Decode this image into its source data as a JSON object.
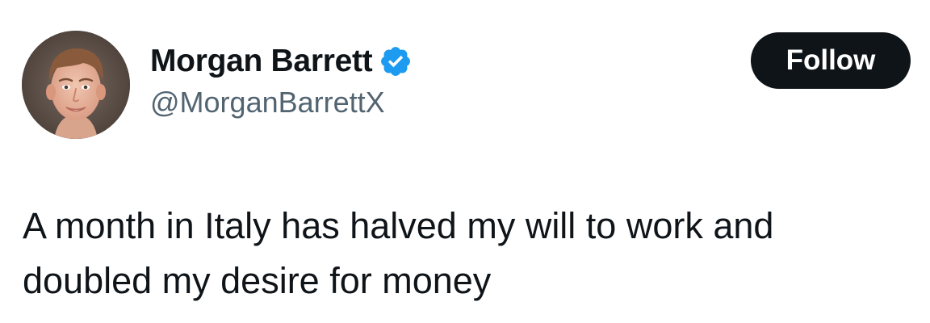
{
  "author": {
    "display_name": "Morgan Barrett",
    "handle": "@MorganBarrettX",
    "verified": true,
    "verified_badge_color": "#1d9bf0"
  },
  "actions": {
    "follow_label": "Follow"
  },
  "tweet": {
    "text": "A month in Italy has halved my will to work and\ndoubled my desire for money"
  },
  "colors": {
    "text_primary": "#0f1419",
    "text_secondary": "#536471",
    "button_bg": "#0f1419",
    "button_text": "#ffffff"
  }
}
